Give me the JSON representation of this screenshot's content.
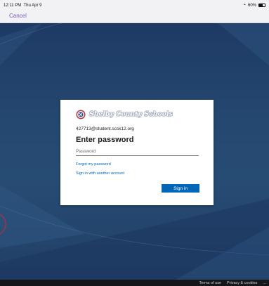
{
  "status_bar": {
    "time": "12:11 PM",
    "date": "Thu Apr 9",
    "battery_text": "60%",
    "battery_level": 0.6
  },
  "nav": {
    "cancel_label": "Cancel"
  },
  "signin_card": {
    "org_name": "Shelby County Schools",
    "email": "427713@student.scsk12.org",
    "heading": "Enter password",
    "password_placeholder": "Password",
    "password_value": "",
    "forgot_link": "Forgot my password",
    "another_account_link": "Sign in with another account",
    "signin_button": "Sign in"
  },
  "footer": {
    "terms": "Terms of use",
    "privacy": "Privacy & cookies",
    "more": "..."
  },
  "colors": {
    "accent": "#0067b8",
    "cancel": "#7a56b8",
    "background": "#24476f"
  }
}
